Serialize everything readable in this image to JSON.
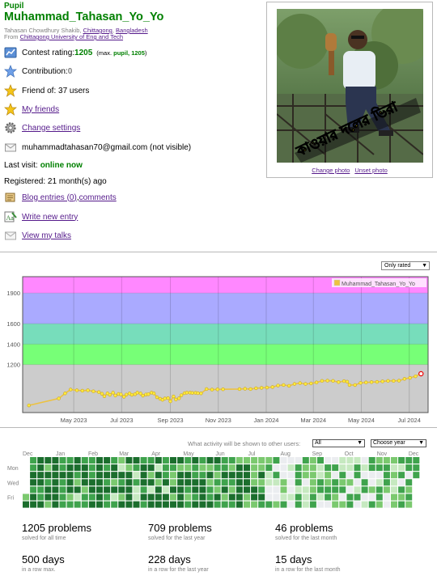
{
  "profile": {
    "rank": "Pupil",
    "handle": "Muhammad_Tahasan_Yo_Yo",
    "name_prefix": "Tahasan Chowdhury Shakib, ",
    "city": "Chittagong",
    "comma": ", ",
    "country": "Bangladesh",
    "from_prefix": "From ",
    "organization": "Chittagong University of Eng and Tech",
    "rating_label": "Contest rating: ",
    "rating_value": "1205",
    "rating_max_prefix": "(max. ",
    "rating_max_rank": "pupil, 1205",
    "rating_max_suffix": ")",
    "contribution_label": "Contribution: ",
    "contribution_value": "0",
    "friend_of": "Friend of: 37 users",
    "my_friends": "My friends",
    "change_settings": "Change settings",
    "email": "muhammadtahasan70@gmail.com (not visible)",
    "last_visit_label": "Last visit: ",
    "last_visit_value": "online now",
    "registered": "Registered: 21 month(s) ago",
    "blog_entries": "Blog entries (0)",
    "blog_sep": ", ",
    "comments": "comments",
    "write_new_entry": "Write new entry",
    "view_my_talks": "View my talks",
    "change_photo": "Change photo",
    "unset_photo": "Unset photo",
    "photo_caption_bn": "কাওয়ার দলের ভিরা"
  },
  "icons": {
    "rating": "rating-chart-icon",
    "contribution": "blue-star-icon",
    "friend_of": "gold-star-icon",
    "my_friends": "gold-star-icon",
    "settings": "gear-icon",
    "email": "envelope-icon",
    "blog": "blog-scroll-icon",
    "write": "write-entry-icon",
    "talks": "talk-envelope-icon"
  },
  "colors": {
    "pupil_green": "#008000",
    "link": "#551a8b",
    "band_newbie": "#cccccc",
    "band_pupil": "#77ff77",
    "band_specialist": "#77ddbb",
    "band_expert": "#aaaaff",
    "band_cm": "#ff88ff",
    "rating_line": "#edc240",
    "heat_levels": [
      "#ebedf0",
      "#c6e9c0",
      "#7bc96f",
      "#3fa34d",
      "#1b6e2d"
    ]
  },
  "graph": {
    "filter": "Only rated",
    "chart_data": {
      "type": "line",
      "title": "",
      "series": [
        {
          "name": "Muhammad_Tahasan_Yo_Yo",
          "x": [
            "2023-03-05",
            "2023-04-12",
            "2023-04-20",
            "2023-04-27",
            "2023-05-05",
            "2023-05-12",
            "2023-05-19",
            "2023-05-26",
            "2023-06-02",
            "2023-06-06",
            "2023-06-09",
            "2023-06-13",
            "2023-06-16",
            "2023-06-20",
            "2023-06-23",
            "2023-06-27",
            "2023-06-30",
            "2023-07-04",
            "2023-07-07",
            "2023-07-11",
            "2023-07-14",
            "2023-07-18",
            "2023-07-21",
            "2023-07-25",
            "2023-07-28",
            "2023-08-01",
            "2023-08-04",
            "2023-08-08",
            "2023-08-11",
            "2023-08-15",
            "2023-08-19",
            "2023-08-22",
            "2023-08-25",
            "2023-08-29",
            "2023-09-01",
            "2023-09-05",
            "2023-09-08",
            "2023-09-12",
            "2023-09-15",
            "2023-09-19",
            "2023-09-22",
            "2023-09-26",
            "2023-09-29",
            "2023-10-03",
            "2023-10-06",
            "2023-10-10",
            "2023-10-17",
            "2023-10-24",
            "2023-10-31",
            "2023-11-07",
            "2023-11-28",
            "2023-12-05",
            "2023-12-12",
            "2023-12-19",
            "2023-12-26",
            "2024-01-02",
            "2024-01-09",
            "2024-01-16",
            "2024-01-23",
            "2024-01-30",
            "2024-02-06",
            "2024-02-13",
            "2024-02-20",
            "2024-02-27",
            "2024-03-05",
            "2024-03-12",
            "2024-03-19",
            "2024-03-26",
            "2024-04-02",
            "2024-04-09",
            "2024-04-13",
            "2024-04-16",
            "2024-04-23",
            "2024-04-30",
            "2024-05-07",
            "2024-05-14",
            "2024-05-21",
            "2024-05-28",
            "2024-06-04",
            "2024-06-11",
            "2024-06-18",
            "2024-06-25",
            "2024-07-02",
            "2024-07-09",
            "2024-07-16"
          ],
          "values": [
            800,
            868,
            918,
            955,
            948,
            944,
            948,
            938,
            930,
            914,
            890,
            918,
            904,
            925,
            897,
            912,
            908,
            885,
            906,
            917,
            904,
            910,
            925,
            917,
            896,
            907,
            910,
            925,
            918,
            880,
            865,
            855,
            868,
            872,
            840,
            888,
            858,
            870,
            900,
            920,
            925,
            925,
            922,
            923,
            920,
            918,
            960,
            955,
            957,
            958,
            960,
            963,
            960,
            968,
            972,
            975,
            980,
            995,
            1000,
            992,
            1010,
            1018,
            1010,
            1015,
            1025,
            1040,
            1042,
            1040,
            1028,
            1038,
            1032,
            1000,
            1000,
            1020,
            1025,
            1028,
            1030,
            1035,
            1040,
            1040,
            1042,
            1060,
            1070,
            1085,
            1110
          ]
        }
      ],
      "x_ticks": [
        "May 2023",
        "Jul 2023",
        "Sep 2023",
        "Nov 2023",
        "Jan 2024",
        "Mar 2024",
        "May 2024",
        "Jul 2024"
      ],
      "y_ticks": [
        1200,
        1400,
        1600,
        1900
      ],
      "ylim": [
        730,
        2060
      ],
      "xlim": [
        "2023-02-25",
        "2024-07-25"
      ],
      "bands": [
        {
          "from": 730,
          "to": 1200,
          "color": "#cccccc"
        },
        {
          "from": 1200,
          "to": 1400,
          "color": "#77ff77"
        },
        {
          "from": 1400,
          "to": 1600,
          "color": "#77ddbb"
        },
        {
          "from": 1600,
          "to": 1900,
          "color": "#aaaaff"
        },
        {
          "from": 1900,
          "to": 2060,
          "color": "#ff88ff"
        }
      ],
      "legend": "top-right",
      "grid": true
    }
  },
  "activity": {
    "label": "What activity will be shown to other users:",
    "scope_value": "All",
    "year_value": "Choose year",
    "months": [
      "Dec",
      "Jan",
      "Feb",
      "Mar",
      "Apr",
      "May",
      "Jun",
      "Jul",
      "Aug",
      "Sep",
      "Oct",
      "Nov",
      "Dec"
    ],
    "weekdays": [
      "Mon",
      "Wed",
      "Fri"
    ],
    "weeks": 54,
    "seed": 7
  },
  "stats": [
    {
      "value": "1205 problems",
      "caption": "solved for all time"
    },
    {
      "value": "709 problems",
      "caption": "solved for the last year"
    },
    {
      "value": "46 problems",
      "caption": "solved for the last month"
    },
    {
      "value": "500 days",
      "caption": "in a row max."
    },
    {
      "value": "228 days",
      "caption": "in a row for the last year"
    },
    {
      "value": "15 days",
      "caption": "in a row for the last month"
    }
  ]
}
